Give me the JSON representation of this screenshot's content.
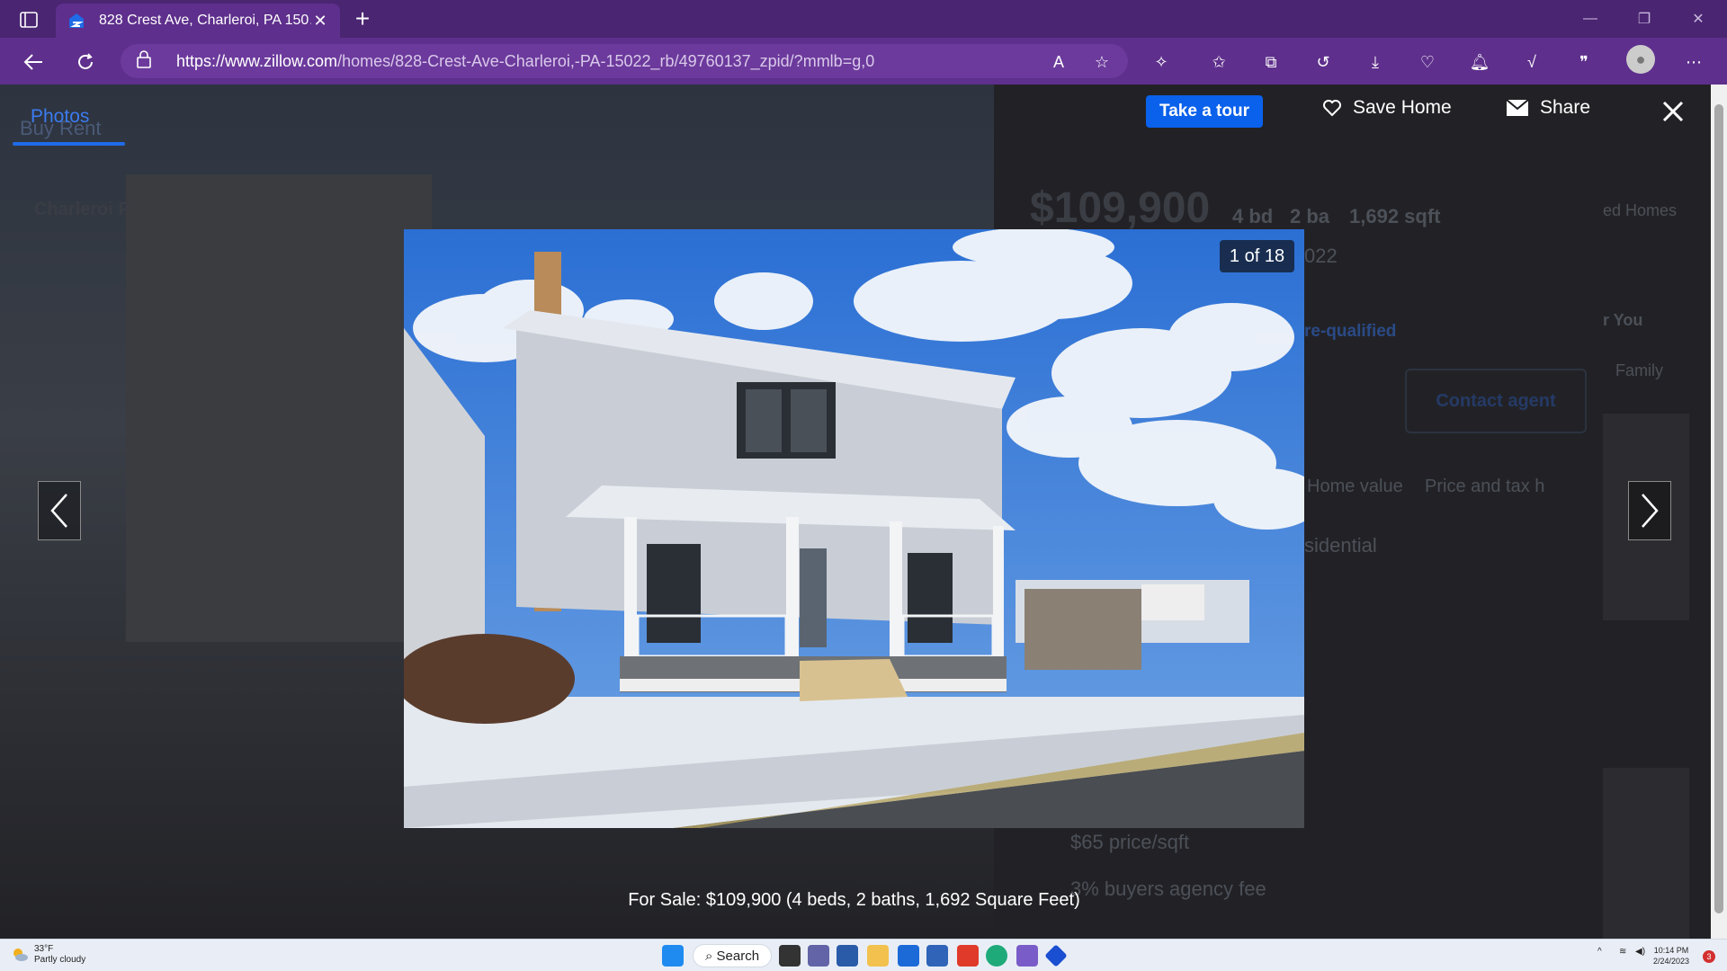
{
  "browser": {
    "tab_title": "828 Crest Ave, Charleroi, PA 150…",
    "url_domain": "https://www.zillow.com",
    "url_path": "/homes/828-Crest-Ave-Charleroi,-PA-15022_rb/49760137_zpid/?mmlb=g,0"
  },
  "lightbox": {
    "photos_tab": "Photos",
    "take_tour": "Take a tour",
    "save_home": "Save Home",
    "share": "Share",
    "counter": "1 of 18",
    "caption": "For Sale: $109,900 (4 beds, 2 baths, 1,692 Square Feet)"
  },
  "background_page": {
    "nav_left": "Buy  Rent",
    "breadcrumb": "Charleroi P",
    "price": "$109,900",
    "beds": "4 bd",
    "baths": "2 ba",
    "sqft": "1,692 sqft",
    "zip_frag": "022",
    "prequal": "re-qualified",
    "contact_agent": "Contact agent",
    "home_value": "Home value",
    "price_tax": "Price and tax h",
    "residential": "sidential",
    "price_sqft": "$65 price/sqft",
    "agency_fee": "3% buyers agency fee",
    "for_you": "r You",
    "family": "Family",
    "homes": "ed Homes"
  },
  "taskbar": {
    "weather_temp": "33°F",
    "weather_desc": "Partly cloudy",
    "search_label": "Search",
    "time": "10:14 PM",
    "date": "2/24/2023"
  },
  "colors": {
    "browser_chrome": "#5e2f8c",
    "zillow_blue": "#0a61eb",
    "sky": "#3b78d6"
  }
}
